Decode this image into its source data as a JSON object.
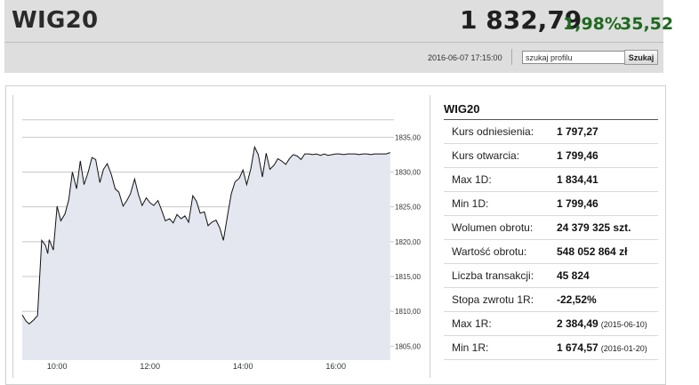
{
  "header": {
    "ticker": "WIG20",
    "price": "1 832,79",
    "change_pct": "1,98%",
    "change_abs": "35,52",
    "datetime": "2016-06-07 17:15:00",
    "search_value": "szukaj profilu",
    "search_button": "Szukaj"
  },
  "colors": {
    "positive": "#1e6a1e",
    "chart_fill": "#e4e7f0",
    "chart_line": "#111111",
    "header_bg": "#dedede"
  },
  "quote": {
    "title": "WIG20",
    "rows": [
      {
        "label": "Kurs odniesienia:",
        "value": "1 797,27",
        "note": ""
      },
      {
        "label": "Kurs otwarcia:",
        "value": "1 799,46",
        "note": ""
      },
      {
        "label": "Max 1D:",
        "value": "1 834,41",
        "note": ""
      },
      {
        "label": "Min 1D:",
        "value": "1 799,46",
        "note": ""
      },
      {
        "label": "Wolumen obrotu:",
        "value": "24 379 325 szt.",
        "note": ""
      },
      {
        "label": "Wartość obrotu:",
        "value": "548 052 864 zł",
        "note": ""
      },
      {
        "label": "Liczba transakcji:",
        "value": "45 824",
        "note": ""
      },
      {
        "label": "Stopa zwrotu 1R:",
        "value": "-22,52%",
        "note": ""
      },
      {
        "label": "Max 1R:",
        "value": "2 384,49",
        "note": "(2015-06-10)"
      },
      {
        "label": "Min 1R:",
        "value": "1 674,57",
        "note": "(2016-01-20)"
      }
    ]
  },
  "chart_data": {
    "type": "area",
    "title": "",
    "xlabel": "",
    "ylabel": "",
    "x_ticks": [
      "10:00",
      "12:00",
      "14:00",
      "16:00"
    ],
    "x_tick_values": [
      10,
      12,
      14,
      16
    ],
    "y_ticks": [
      "1805,00",
      "1810,00",
      "1815,00",
      "1820,00",
      "1825,00",
      "1830,00",
      "1835,00"
    ],
    "y_tick_values": [
      1805,
      1810,
      1815,
      1820,
      1825,
      1830,
      1835
    ],
    "xlim": [
      9.25,
      17.25
    ],
    "ylim": [
      1803,
      1839
    ],
    "grid": true,
    "series": [
      {
        "x": [
          9.25,
          9.33,
          9.4,
          9.5,
          9.58,
          9.67,
          9.75,
          9.8,
          9.83,
          9.92,
          10.0,
          10.08,
          10.17,
          10.25,
          10.33,
          10.42,
          10.5,
          10.58,
          10.67,
          10.75,
          10.83,
          10.92,
          11.0,
          11.08,
          11.17,
          11.25,
          11.33,
          11.42,
          11.5,
          11.58,
          11.67,
          11.75,
          11.83,
          11.92,
          12.0,
          12.08,
          12.17,
          12.25,
          12.33,
          12.42,
          12.5,
          12.58,
          12.67,
          12.75,
          12.83,
          12.92,
          13.0,
          13.08,
          13.17,
          13.25,
          13.33,
          13.42,
          13.5,
          13.58,
          13.67,
          13.75,
          13.83,
          13.92,
          14.0,
          14.08,
          14.17,
          14.25,
          14.33,
          14.42,
          14.5,
          14.58,
          14.67,
          14.75,
          14.83,
          14.92,
          15.0,
          15.08,
          15.17,
          15.25,
          15.33,
          15.42,
          15.5,
          15.58,
          15.67,
          15.75,
          15.83,
          15.92,
          16.0,
          16.08,
          16.17,
          16.25,
          16.33,
          16.42,
          16.5,
          16.58,
          16.67,
          16.75,
          16.83,
          16.92,
          17.0,
          17.08,
          17.17
        ],
        "y": [
          1809.5,
          1808.6,
          1808.2,
          1808.8,
          1809.4,
          1820.2,
          1819.5,
          1818.3,
          1820.3,
          1818.8,
          1825.1,
          1823.0,
          1824.0,
          1826.0,
          1830.0,
          1827.6,
          1831.6,
          1828.2,
          1830.0,
          1832.1,
          1831.8,
          1828.5,
          1830.4,
          1831.2,
          1829.6,
          1827.6,
          1827.1,
          1825.1,
          1825.9,
          1826.9,
          1829.0,
          1826.8,
          1825.2,
          1826.3,
          1825.6,
          1825.2,
          1825.9,
          1824.5,
          1823.0,
          1823.3,
          1822.7,
          1823.9,
          1823.3,
          1823.7,
          1822.8,
          1826.6,
          1825.8,
          1824.1,
          1824.3,
          1822.3,
          1822.8,
          1823.1,
          1822.0,
          1820.2,
          1823.8,
          1826.9,
          1828.6,
          1829.1,
          1830.3,
          1828.2,
          1830.5,
          1833.6,
          1832.5,
          1829.3,
          1832.7,
          1830.4,
          1831.0,
          1831.9,
          1831.6,
          1831.1,
          1831.9,
          1832.5,
          1832.3,
          1831.8,
          1832.6,
          1832.6,
          1832.5,
          1832.6,
          1832.4,
          1832.6,
          1832.4,
          1832.5,
          1832.6,
          1832.6,
          1832.5,
          1832.6,
          1832.6,
          1832.6,
          1832.5,
          1832.6,
          1832.6,
          1832.5,
          1832.6,
          1832.6,
          1832.6,
          1832.6,
          1832.79
        ]
      }
    ]
  }
}
